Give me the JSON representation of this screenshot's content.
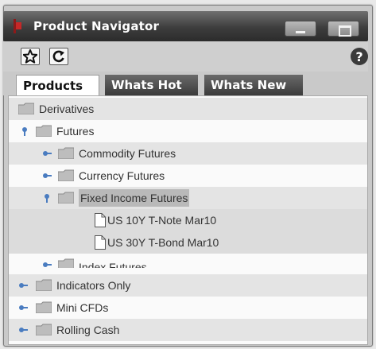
{
  "window": {
    "title": "Product Navigator"
  },
  "toolbar": {
    "help_label": "?"
  },
  "tabs": [
    {
      "label": "Products",
      "active": true
    },
    {
      "label": "Whats Hot",
      "active": false
    },
    {
      "label": "Whats New",
      "active": false
    }
  ],
  "tree": {
    "items": [
      {
        "label": "Derivatives",
        "type": "folder",
        "level": 0
      },
      {
        "label": "Futures",
        "type": "folder",
        "level": 1,
        "expanded": true
      },
      {
        "label": "Commodity Futures",
        "type": "folder",
        "level": 2
      },
      {
        "label": "Currency Futures",
        "type": "folder",
        "level": 2
      },
      {
        "label": "Fixed Income Futures",
        "type": "folder",
        "level": 2,
        "expanded": true,
        "selected": true
      },
      {
        "label": "US 10Y T-Note Mar10",
        "type": "document",
        "level": 3
      },
      {
        "label": "US 30Y T-Bond Mar10",
        "type": "document",
        "level": 3
      },
      {
        "label": "Index Futures",
        "type": "folder",
        "level": 2
      },
      {
        "label": "Indicators Only",
        "type": "folder",
        "level": 0
      },
      {
        "label": "Mini CFDs",
        "type": "folder",
        "level": 0
      },
      {
        "label": "Rolling Cash",
        "type": "folder",
        "level": 0
      }
    ]
  },
  "colors": {
    "titlebar": "#3d3d3d",
    "expander_blue": "#4a7cc0",
    "selection": "#b9b9b9"
  }
}
